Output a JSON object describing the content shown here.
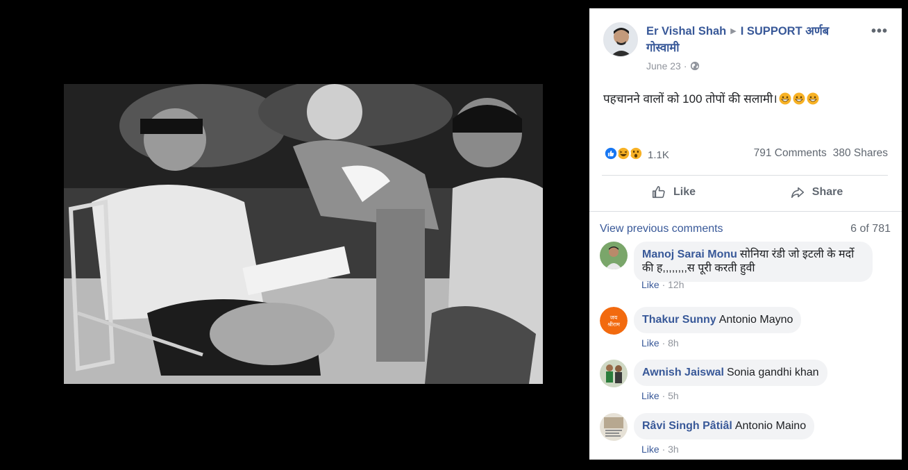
{
  "post": {
    "author": "Er Vishal Shah",
    "target_page": "I SUPPORT अर्णब गोस्वामी",
    "date": "June 23",
    "text": "पहचानने वालों को 100 तोपों की सलामी।",
    "more_label": "•••",
    "reaction_count": "1.1K",
    "comments_count": "791 Comments",
    "shares_count": "380 Shares",
    "like_label": "Like",
    "share_label": "Share"
  },
  "comments_section": {
    "view_previous": "View previous comments",
    "count": "6 of 781",
    "items": [
      {
        "name": "Manoj Sarai Monu",
        "text": "सोनिया रंडी जो इटली के मर्दो की ह,,,,,,,,स पूरी करती हुवी",
        "like": "Like",
        "time": "12h"
      },
      {
        "name": "Thakur Sunny",
        "text": "Antonio Mayno",
        "like": "Like",
        "time": "8h"
      },
      {
        "name": "Awnish Jaiswal",
        "text": "Sonia gandhi khan",
        "like": "Like",
        "time": "5h"
      },
      {
        "name": "Râvi Singh Pâtiâl",
        "text": "Antonio Maino",
        "like": "Like",
        "time": "3h"
      }
    ]
  },
  "icons": {
    "reactions": [
      "like-reaction-icon",
      "haha-reaction-icon",
      "wow-reaction-icon"
    ],
    "emoji": "grinning-emoji-icon"
  },
  "colors": {
    "link": "#385898",
    "muted": "#606770",
    "like_blue": "#1877f2",
    "reaction_yellow": "#f7b125"
  }
}
